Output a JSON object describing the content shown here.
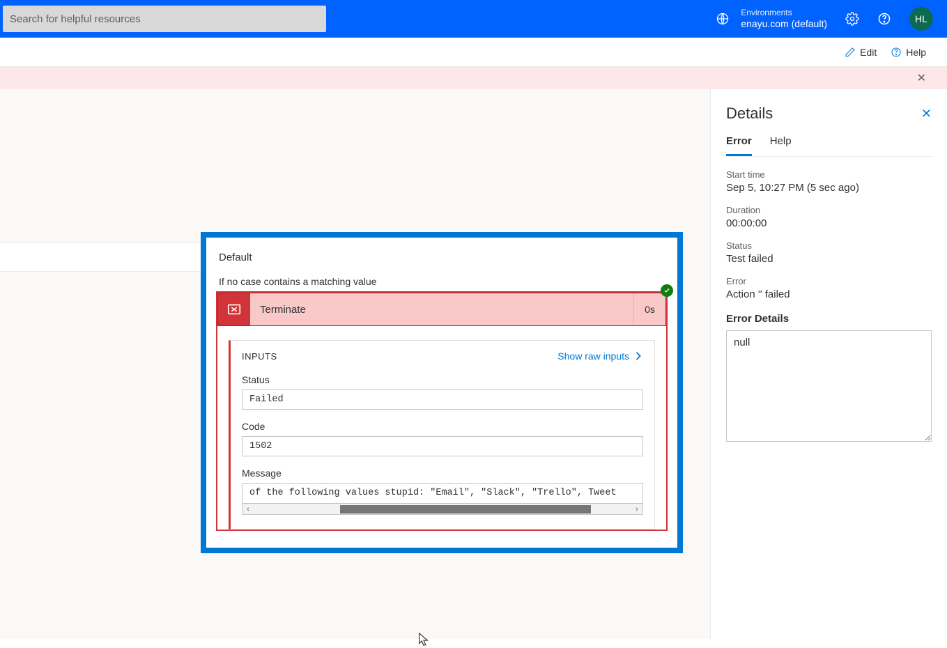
{
  "topbar": {
    "search_placeholder": "Search for helpful resources",
    "env_label": "Environments",
    "env_value": "enayu.com (default)",
    "avatar_initials": "HL"
  },
  "cmdbar": {
    "edit": "Edit",
    "help": "Help"
  },
  "flow": {
    "case_label": "Default",
    "case_subtitle": "If no case contains a matching value",
    "terminate_label": "Terminate",
    "terminate_time": "0s",
    "inputs_header": "INPUTS",
    "raw_inputs_link": "Show raw inputs",
    "fields": {
      "status_label": "Status",
      "status_value": "Failed",
      "code_label": "Code",
      "code_value": "1502",
      "message_label": "Message",
      "message_value": "of the following values stupid: \"Email\", \"Slack\", \"Trello\", Tweet"
    }
  },
  "details": {
    "title": "Details",
    "tabs": {
      "error": "Error",
      "help": "Help"
    },
    "start_time_label": "Start time",
    "start_time_value": "Sep 5, 10:27 PM (5 sec ago)",
    "duration_label": "Duration",
    "duration_value": "00:00:00",
    "status_label": "Status",
    "status_value": "Test failed",
    "error_label": "Error",
    "error_value": "Action '' failed",
    "error_details_label": "Error Details",
    "error_details_value": "null"
  }
}
